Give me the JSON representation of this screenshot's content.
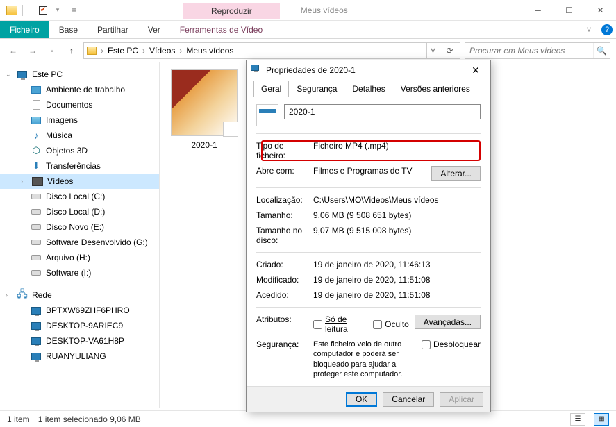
{
  "window": {
    "title": "Meus vídeos",
    "contextTab": "Reproduzir",
    "minimize": "–",
    "maximize": "▢",
    "close": "✕"
  },
  "ribbon": {
    "file": "Ficheiro",
    "tabs": [
      "Base",
      "Partilhar",
      "Ver"
    ],
    "contextTool": "Ferramentas de Vídeo"
  },
  "address": {
    "crumbs": [
      "Este PC",
      "Vídeos",
      "Meus vídeos"
    ],
    "searchPlaceholder": "Procurar em Meus vídeos"
  },
  "nav": {
    "root": "Este PC",
    "items": [
      {
        "label": "Ambiente de trabalho",
        "icon": "desktop"
      },
      {
        "label": "Documentos",
        "icon": "document"
      },
      {
        "label": "Imagens",
        "icon": "image"
      },
      {
        "label": "Música",
        "icon": "music"
      },
      {
        "label": "Objetos 3D",
        "icon": "obj3d"
      },
      {
        "label": "Transferências",
        "icon": "download"
      },
      {
        "label": "Vídeos",
        "icon": "video",
        "selected": true
      },
      {
        "label": "Disco Local (C:)",
        "icon": "disk"
      },
      {
        "label": "Disco Local (D:)",
        "icon": "disk"
      },
      {
        "label": "Disco Novo (E:)",
        "icon": "disk"
      },
      {
        "label": "Software Desenvolvido (G:)",
        "icon": "disk"
      },
      {
        "label": "Arquivo (H:)",
        "icon": "disk"
      },
      {
        "label": "Software (I:)",
        "icon": "disk"
      }
    ],
    "network": "Rede",
    "computers": [
      "BPTXW69ZHF6PHRO",
      "DESKTOP-9ARIEC9",
      "DESKTOP-VA61H8P",
      "RUANYULIANG"
    ]
  },
  "content": {
    "fileName": "2020-1"
  },
  "status": {
    "count": "1 item",
    "selection": "1 item selecionado 9,06 MB"
  },
  "dialog": {
    "title": "Propriedades de 2020-1",
    "tabs": [
      "Geral",
      "Segurança",
      "Detalhes",
      "Versões anteriores"
    ],
    "name": "2020-1",
    "fields": {
      "typeLabel": "Tipo de ficheiro:",
      "typeValue": "Ficheiro MP4 (.mp4)",
      "opensLabel": "Abre com:",
      "opensValue": "Filmes e Programas de TV",
      "changeBtn": "Alterar...",
      "locationLabel": "Localização:",
      "locationValue": "C:\\Users\\MO\\Videos\\Meus vídeos",
      "sizeLabel": "Tamanho:",
      "sizeValue": "9,06 MB (9 508 651 bytes)",
      "sizeDiskLabel": "Tamanho no disco:",
      "sizeDiskValue": "9,07 MB (9 515 008 bytes)",
      "createdLabel": "Criado:",
      "createdValue": "19 de janeiro de 2020, 11:46:13",
      "modifiedLabel": "Modificado:",
      "modifiedValue": "19 de janeiro de 2020, 11:51:08",
      "accessedLabel": "Acedido:",
      "accessedValue": "19 de janeiro de 2020, 11:51:08",
      "attrLabel": "Atributos:",
      "readonly": "Só de leitura",
      "hidden": "Oculto",
      "advanced": "Avançadas...",
      "securityLabel": "Segurança:",
      "securityText": "Este ficheiro veio de outro computador e poderá ser bloqueado para ajudar a proteger este computador.",
      "unblock": "Desbloquear"
    },
    "buttons": {
      "ok": "OK",
      "cancel": "Cancelar",
      "apply": "Aplicar"
    }
  }
}
